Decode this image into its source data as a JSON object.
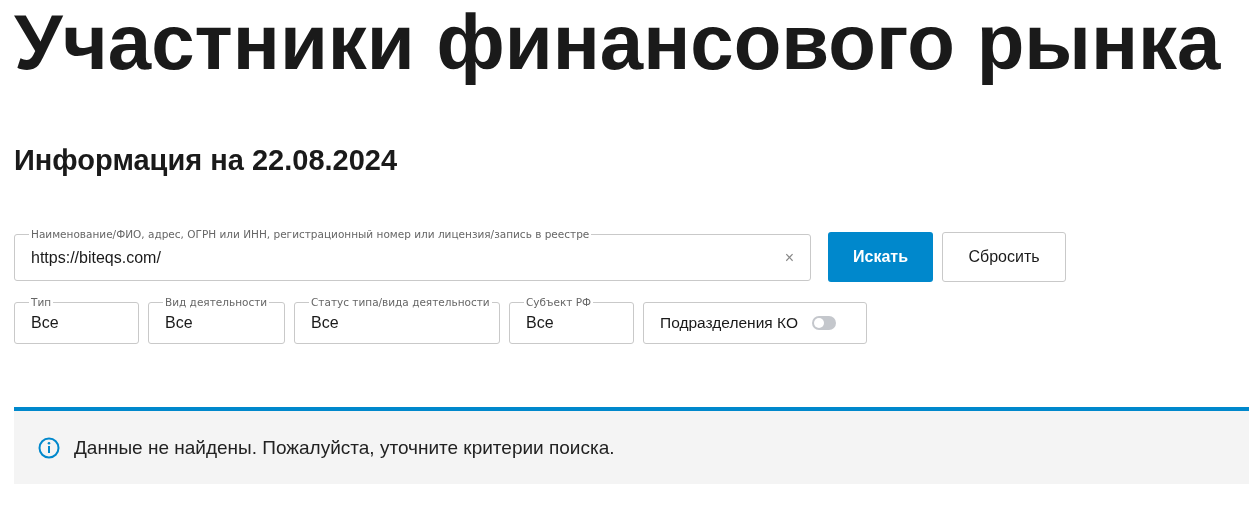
{
  "title": "Участники финансового рынка",
  "subtitle": "Информация на 22.08.2024",
  "search": {
    "label": "Наименование/ФИО, адрес, ОГРН или ИНН, регистрационный номер или лицензия/запись в реестре",
    "value": "https://biteqs.com/",
    "clear": "×"
  },
  "buttons": [
    {
      "label": "Искать",
      "kind": "primary"
    },
    {
      "label": "Сбросить",
      "kind": "secondary"
    }
  ],
  "filters": [
    {
      "label": "Тип",
      "value": "Все"
    },
    {
      "label": "Вид деятельности",
      "value": "Все"
    },
    {
      "label": "Статус типа/вида деятельности",
      "value": "Все"
    },
    {
      "label": "Субъект РФ",
      "value": "Все"
    }
  ],
  "toggle": {
    "label": "Подразделения КО",
    "on": false
  },
  "message": "Данные не найдены. Пожалуйста, уточните критерии поиска."
}
